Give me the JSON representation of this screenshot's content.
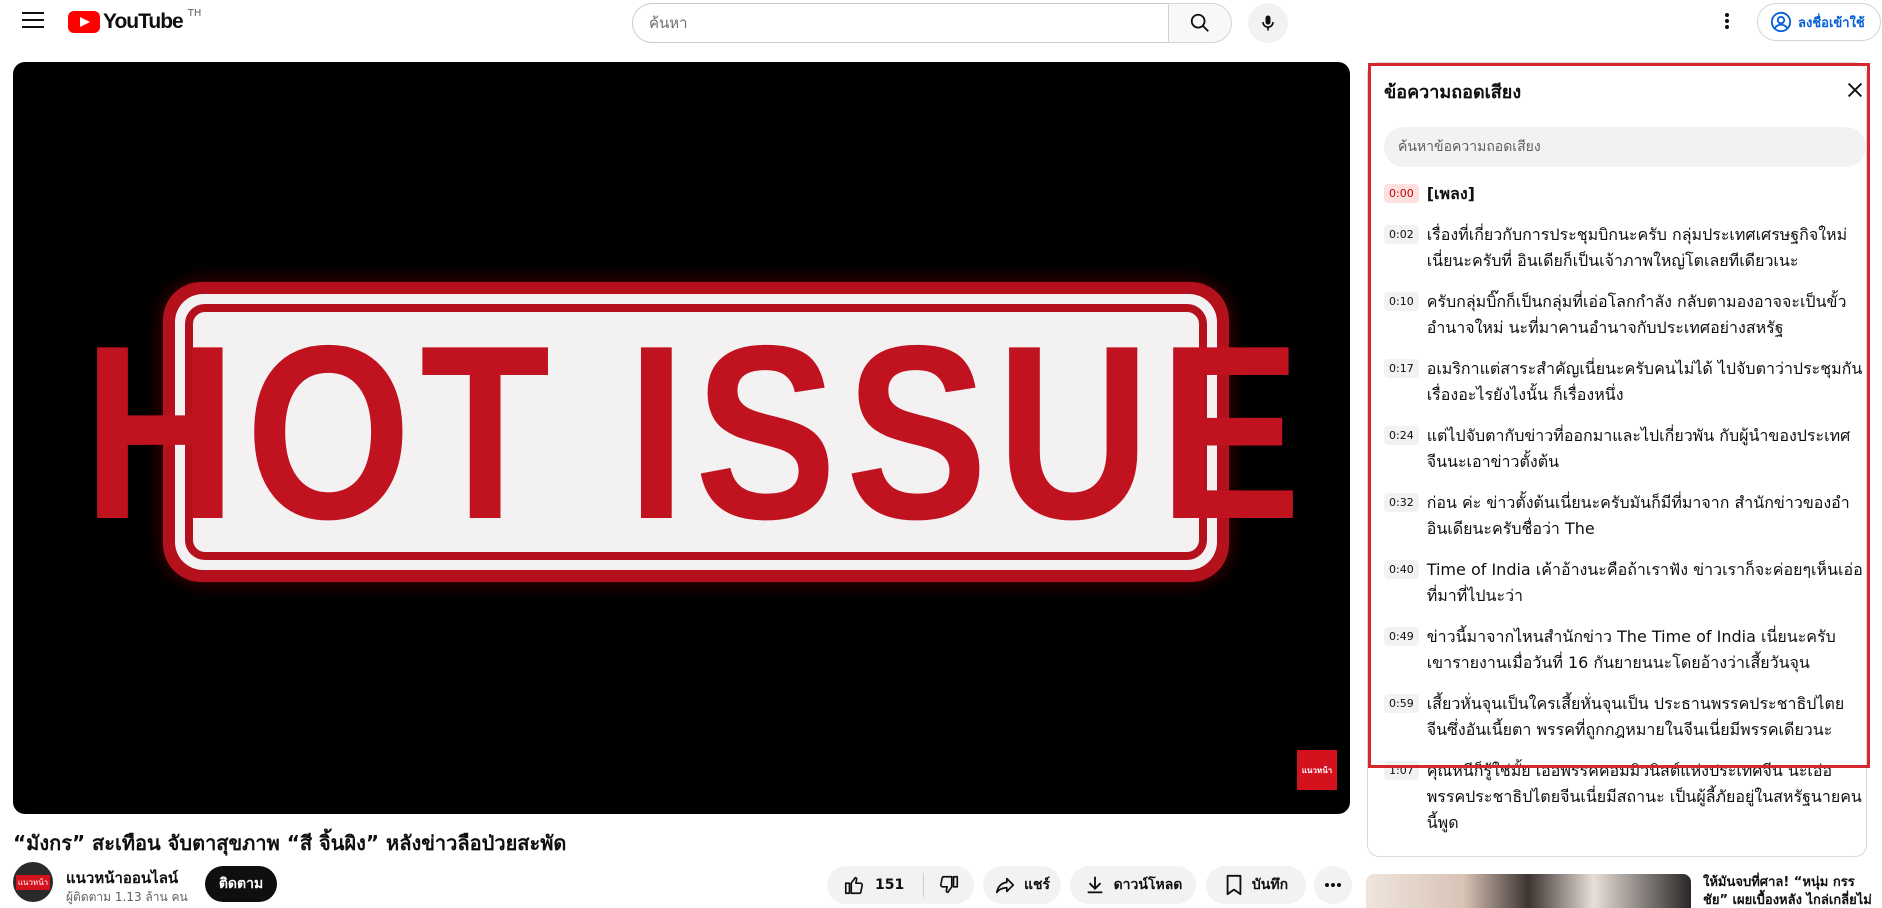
{
  "header": {
    "logo_text": "YouTube",
    "logo_country": "TH",
    "search_placeholder": "ค้นหา",
    "signin_label": "ลงชื่อเข้าใช้"
  },
  "player": {
    "frame_text": "HOT ISSUE",
    "channel_watermark": "แนวหน้า"
  },
  "video": {
    "title": "“มังกร” สะเทือน จับตาสุขภาพ “สี จิ้นผิง” หลังข่าวลือป่วยสะพัด",
    "channel_name": "แนวหน้าออนไลน์",
    "subscriber_count": "ผู้ติดตาม 1.13 ล้าน คน",
    "subscribe_label": "ติดตาม",
    "like_count": "151",
    "share_label": "แชร์",
    "download_label": "ดาวน์โหลด",
    "save_label": "บันทึก"
  },
  "transcript": {
    "title": "ข้อความถอดเสียง",
    "search_placeholder": "ค้นหาข้อความถอดเสียง",
    "segments": [
      {
        "time": "0:00",
        "text": "[เพลง]"
      },
      {
        "time": "0:02",
        "text": "เรื่องที่เกี่ยวกับการประชุมบิกนะครับ กลุ่มประเทศเศรษฐกิจใหม่เนี่ยนะครับที่ อินเดียก็เป็นเจ้าภาพใหญ่โตเลยทีเดียวเนะ"
      },
      {
        "time": "0:10",
        "text": "ครับกลุ่มบิ๊กก็เป็นกลุ่มที่เอ่อโลกกำลัง กลับตามองอาจจะเป็นขั้วอำนาจใหม่ นะที่มาคานอำนาจกับประเทศอย่างสหรัฐ"
      },
      {
        "time": "0:17",
        "text": "อเมริกาแต่สาระสำคัญเนี่ยนะครับคนไม่ได้ ไปจับตาว่าประชุมกันเรื่องอะไรยังไงนั้น ก็เรื่องหนึ่ง"
      },
      {
        "time": "0:24",
        "text": "แต่ไปจับตากับข่าวที่ออกมาและไปเกี่ยวพัน กับผู้นำของประเทศจีนนะเอาข่าวตั้งต้น"
      },
      {
        "time": "0:32",
        "text": "ก่อน ค่ะ ข่าวตั้งต้นเนี่ยนะครับมันก็มีที่มาจาก สำนักข่าวของอำอินเดียนะครับชื่อว่า The"
      },
      {
        "time": "0:40",
        "text": " Time of India เค้าอ้างนะคือถ้าเราฟัง ข่าวเราก็จะค่อยๆเห็นเอ่อที่มาที่ไปนะว่า"
      },
      {
        "time": "0:49",
        "text": "ข่าวนี้มาจากไหนสำนักข่าว The Time of India เนี่ยนะครับ เขารายงานเมื่อวันที่ 16 กันยายนนะโดยอ้างว่าเสี้ยวันจุน"
      },
      {
        "time": "0:59",
        "text": "เสี้ยวหั่นจุนเป็นใครเสี้ยหั่นจุนเป็น ประธานพรรคประชาธิปไตยจีนซึ่งอันเนี้ยตา พรรคที่ถูกกฎหมายในจีนเนี่ยมีพรรคเดียวนะ"
      },
      {
        "time": "1:07",
        "text": "คุณหนีก็รู้ใช่มั้ย เออพรรคคอมมิวนิสต์แห่งประเทศจีน นะเอ่อพรรคประชาธิปไตยจีนเนี่ยมีสถานะ เป็นผู้ลี้ภัยอยู่ในสหรัฐนายคนนี้พูด"
      }
    ]
  },
  "recommendation": {
    "title": "ให้มันจบที่ศาล! “หนุ่ม กรรชัย” เผยเบื้องหลัง ไกล่เกลี่ยไม่ลงตัว"
  }
}
